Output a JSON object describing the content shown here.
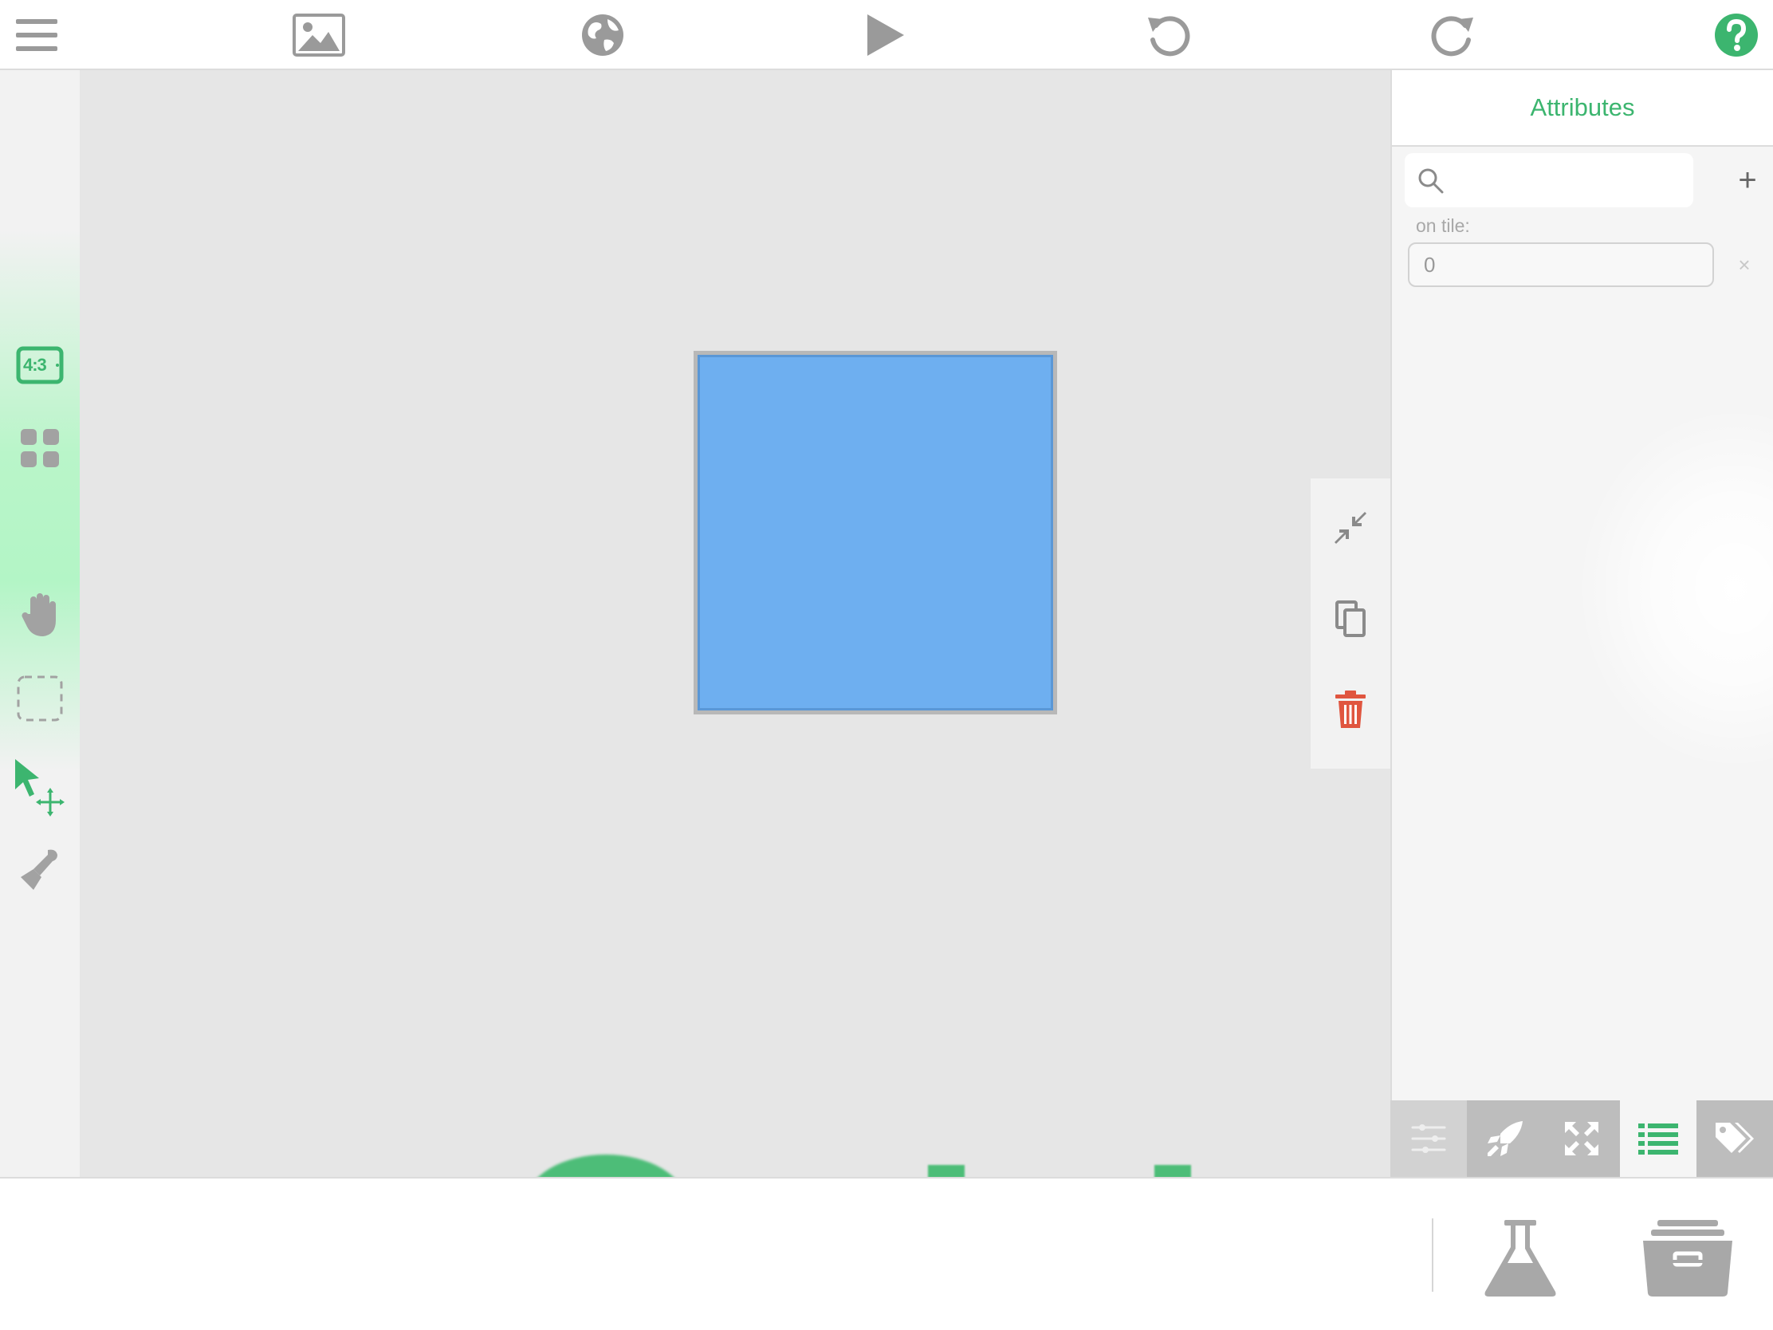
{
  "toolbar": {
    "icons": [
      "menu-icon",
      "image-icon",
      "globe-icon",
      "play-icon",
      "undo-icon",
      "redo-icon",
      "help-icon"
    ]
  },
  "left_tools": {
    "aspect_ratio_label": "4:3",
    "icons": [
      "aspect-ratio-icon",
      "grid-icon",
      "hand-icon",
      "marquee-select-icon",
      "select-move-icon",
      "stamp-icon"
    ]
  },
  "object_tools": {
    "icons": [
      "shrink-icon",
      "duplicate-icon",
      "trash-icon"
    ]
  },
  "panel": {
    "tab_label": "Attributes",
    "search_placeholder": "",
    "add_label": "+",
    "attribute": {
      "label": "on tile:",
      "value": "0",
      "clear_label": "×"
    },
    "bottom_tabs": [
      "sliders-icon",
      "rocket-icon",
      "expand-icon",
      "list-icon",
      "tag-icon"
    ]
  },
  "tray": {
    "icons": [
      "flask-icon",
      "archive-icon"
    ]
  },
  "colors": {
    "accent": "#3cb56f",
    "shape_fill": "#6eaff0",
    "delete": "#e0553f",
    "canvas": "#e6e6e6"
  }
}
